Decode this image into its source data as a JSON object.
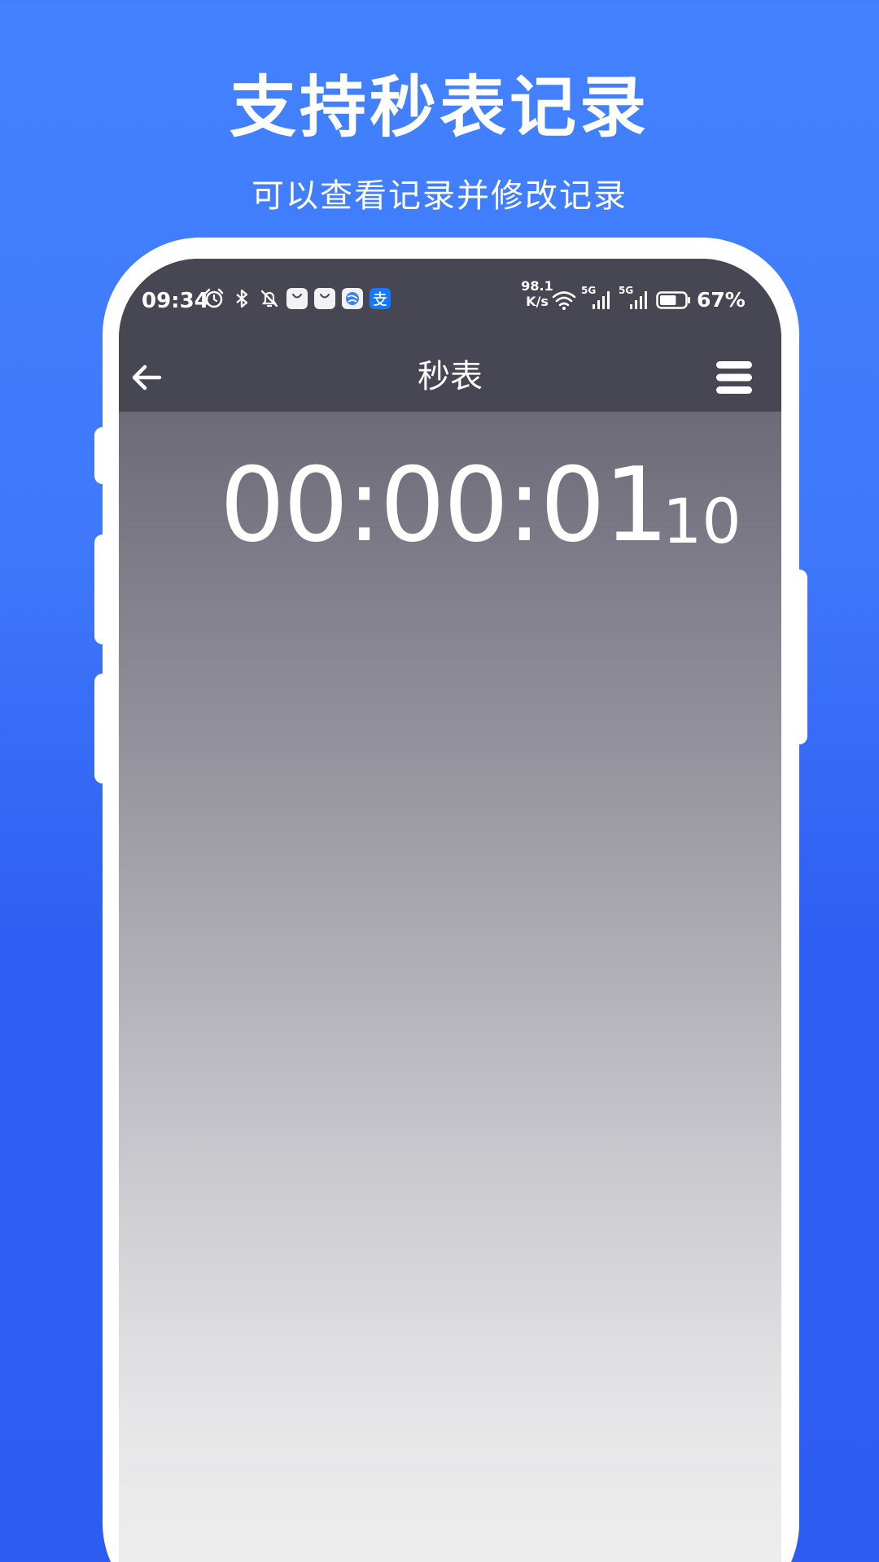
{
  "promo": {
    "headline": "支持秒表记录",
    "subline": "可以查看记录并修改记录"
  },
  "status_bar": {
    "time": "09:34",
    "net_speed_value": "98.1",
    "net_speed_unit": "K/s",
    "signal_1": "5G",
    "signal_2": "5G",
    "battery_percent": "67%",
    "battery_level": 0.67,
    "left_icons": [
      "alarm-icon",
      "bluetooth-icon",
      "mute-bell-icon",
      "shopping-bag-icon",
      "shopping-bag-icon",
      "browser-icon",
      "alipay-icon"
    ],
    "right_icons": [
      "wifi-icon",
      "cellular-signal-icon",
      "cellular-signal-icon",
      "battery-icon"
    ]
  },
  "nav": {
    "title": "秒表",
    "back_icon": "arrow-left-icon",
    "menu_icon": "hamburger-menu-icon"
  },
  "stopwatch": {
    "main": "00:00:01",
    "fraction": "10"
  },
  "colors": {
    "background_top": "#4282fe",
    "background_bottom": "#2d5cf1",
    "topbar": "#474653",
    "text": "#ffffff",
    "alipay": "#1677ff"
  }
}
